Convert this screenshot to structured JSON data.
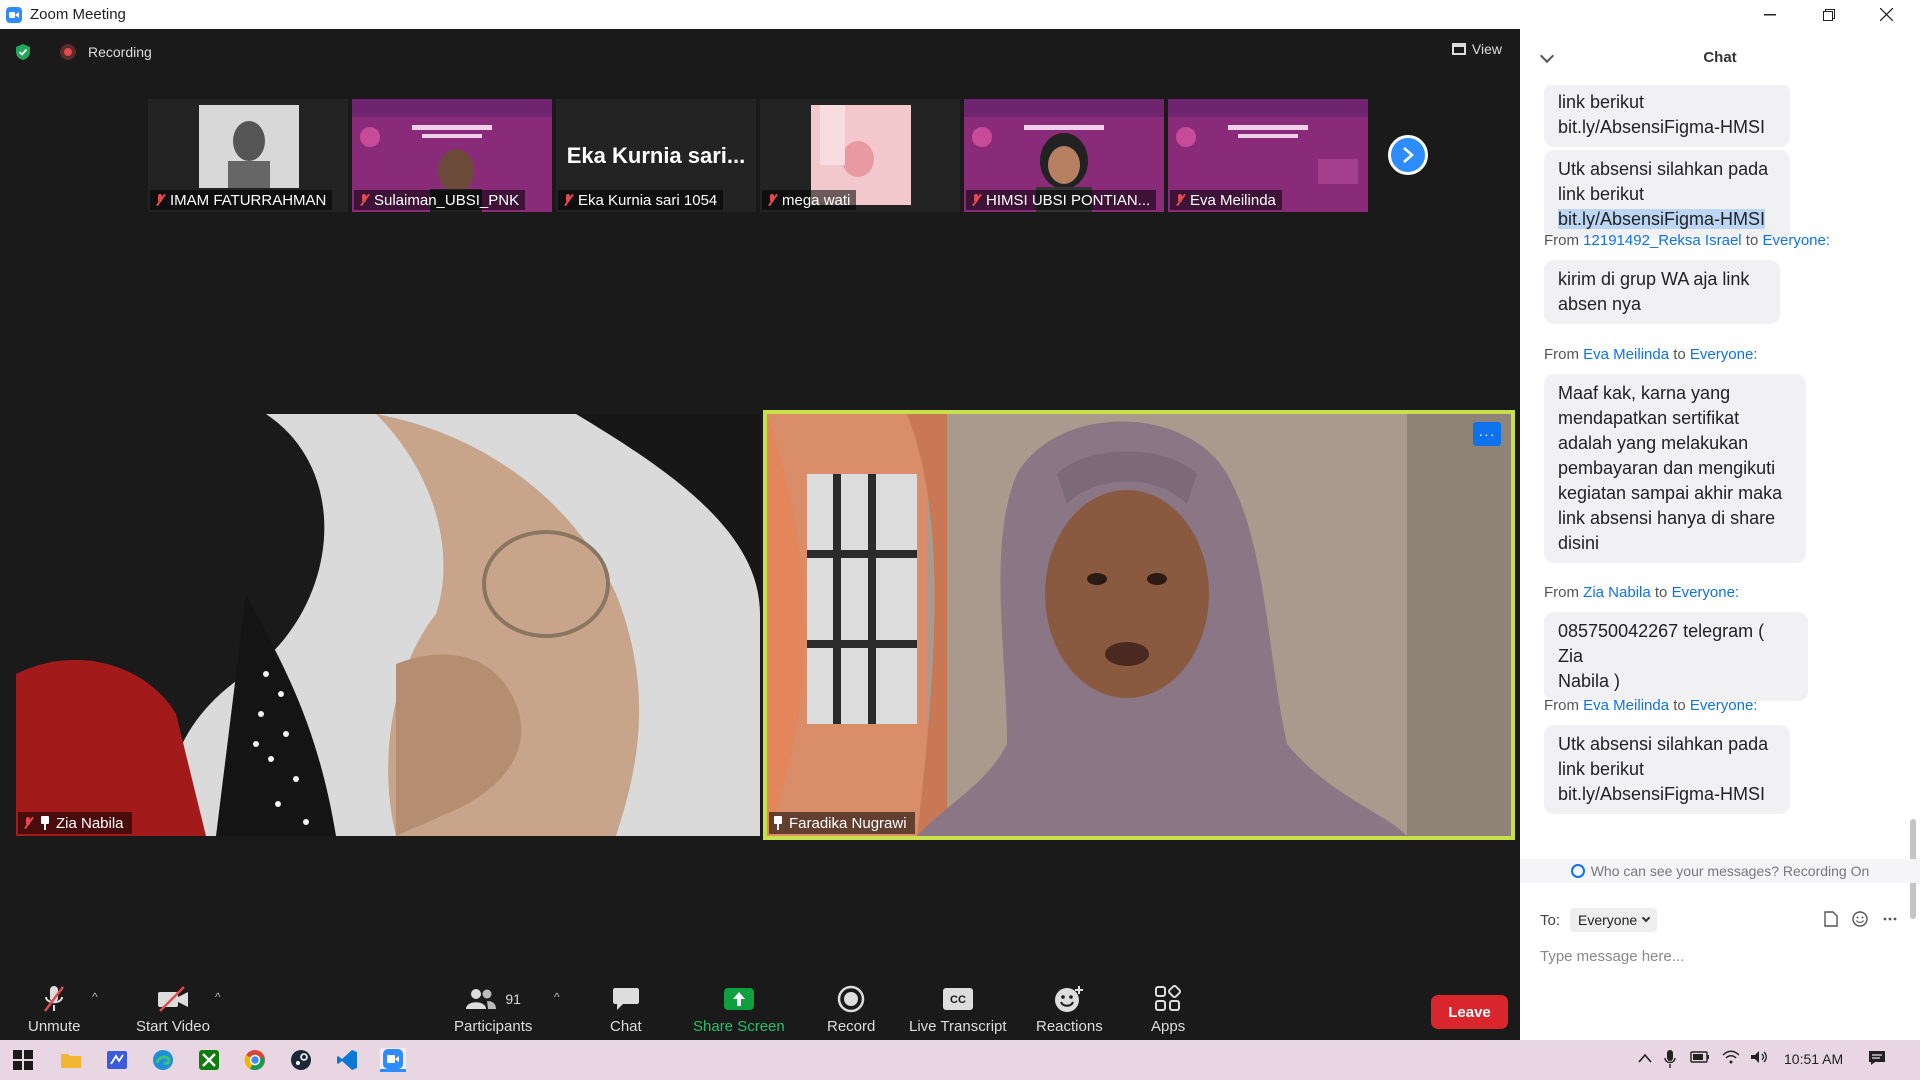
{
  "window": {
    "title": "Zoom Meeting"
  },
  "meeting": {
    "recording_label": "Recording",
    "view_label": "View",
    "strip": [
      {
        "name": "IMAM FATURRAHMAN"
      },
      {
        "name": "Sulaiman_UBSI_PNK"
      },
      {
        "name": "Eka Kurnia sari 1054",
        "display_title": "Eka Kurnia sari..."
      },
      {
        "name": "mega wati"
      },
      {
        "name": "HIMSI UBSI PONTIAN..."
      },
      {
        "name": "Eva Meilinda"
      }
    ],
    "videos": [
      {
        "name": "Zia Nabila"
      },
      {
        "name": "Faradika Nugrawi"
      }
    ],
    "more_label": "···"
  },
  "toolbar": {
    "unmute": "Unmute",
    "start_video": "Start Video",
    "participants": "Participants",
    "participants_count": "91",
    "chat": "Chat",
    "share_screen": "Share Screen",
    "record": "Record",
    "live_transcript": "Live Transcript",
    "reactions": "Reactions",
    "apps": "Apps",
    "leave": "Leave",
    "colors": {
      "share": "#0e9f3e",
      "leave": "#d9252b"
    }
  },
  "chat": {
    "title": "Chat",
    "messages": [
      {
        "lines": [
          "link berikut",
          "bit.ly/AbsensiFigma-HMSI"
        ]
      },
      {
        "lines": [
          "Utk absensi silahkan pada",
          "link berikut",
          "bit.ly/AbsensiFigma-HMSI"
        ]
      },
      {
        "from": "12191492_Reksa Israel",
        "to": "Everyone:",
        "lines": [
          "kirim di grup WA aja link",
          "absen nya"
        ]
      },
      {
        "from": "Eva Meilinda",
        "to": "Everyone:",
        "lines": [
          "Maaf kak, karna yang",
          "mendapatkan sertifikat",
          "adalah yang melakukan",
          "pembayaran dan mengikuti",
          "kegiatan sampai akhir maka",
          "link absensi hanya di share",
          "disini"
        ]
      },
      {
        "from": "Zia Nabila",
        "to": "Everyone:",
        "lines": [
          "085750042267 telegram ( Zia",
          "Nabila )"
        ]
      },
      {
        "from": "Eva Meilinda",
        "to": "Everyone:",
        "lines": [
          "Utk absensi silahkan pada",
          "link berikut",
          "bit.ly/AbsensiFigma-HMSI"
        ]
      }
    ],
    "from_word": "From",
    "to_word": "to",
    "privacy": "Who can see your messages? Recording On",
    "to_label": "To:",
    "to_value": "Everyone",
    "input_placeholder": "Type message here..."
  },
  "taskbar": {
    "time": "10:51 AM"
  }
}
